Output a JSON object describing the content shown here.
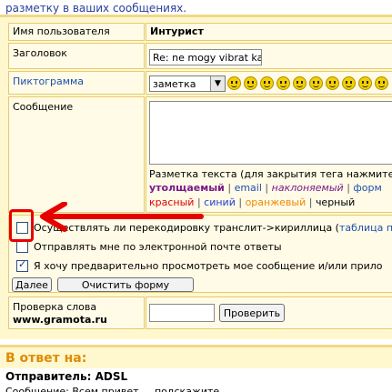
{
  "top_note": "разметку в ваших сообщениях.",
  "form": {
    "username": {
      "label": "Имя пользователя",
      "value": "Интурист"
    },
    "subject": {
      "label": "Заголовок",
      "value": "Re: ne mogy vibrat ka"
    },
    "icon": {
      "label": "Пиктограмма",
      "selected": "заметка"
    },
    "message": {
      "label": "Сообщение"
    },
    "markup": {
      "title": "Разметка текста (для закрытия тега нажмите",
      "styles": [
        "утолщаемый",
        "email",
        "наклоняемый",
        "форм"
      ],
      "colors": [
        "красный",
        "синий",
        "оранжевый",
        "черный"
      ],
      "sep": "|"
    },
    "options": [
      {
        "label": "Осуществлять ли перекодировку транслит->кириллица (",
        "link": "таблица п",
        "checked": false
      },
      {
        "label": "Отправлять мне по электронной почте ответы",
        "checked": false
      },
      {
        "label": "Я хочу предварительно просмотреть мое сообщение и/или прило",
        "checked": true
      }
    ],
    "buttons": {
      "next": "Далее",
      "clear": "Очистить форму"
    },
    "spellcheck": {
      "label": "Проверка слова",
      "site": "www.gramota.ru",
      "button": "Проверить"
    }
  },
  "reply": {
    "title": "В ответ на:",
    "sender": "Отправитель: ADSL",
    "cut_line": "Сообщение: Всем привет ... подскажите ..."
  },
  "colors": {
    "accent_border": "#e6c970",
    "panel_bg": "#fff8cf",
    "annotation": "#e60000"
  },
  "icons": [
    "chevron-down-icon",
    "smiley-icon",
    "checkbox-icon",
    "annotation-arrow-icon"
  ]
}
